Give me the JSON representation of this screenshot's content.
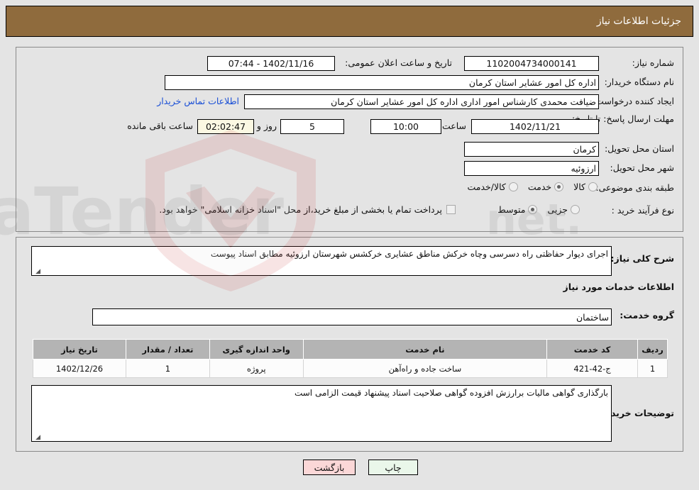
{
  "header": {
    "title": "جزئیات اطلاعات نیاز"
  },
  "form": {
    "need_number_label": "شماره نیاز:",
    "need_number_value": "1102004734000141",
    "public_announce_label": "تاریخ و ساعت اعلان عمومی:",
    "public_announce_value": "1402/11/16 - 07:44",
    "buyer_org_label": "نام دستگاه خریدار:",
    "buyer_org_value": "اداره کل امور عشایر استان کرمان",
    "requester_label": "ایجاد کننده درخواست:",
    "requester_value": "ضیافت محمدی کارشناس امور اداری اداره کل امور عشایر استان کرمان",
    "buyer_contact_link": "اطلاعات تماس خریدار",
    "deadline_label": "مهلت ارسال پاسخ: تا تاریخ:",
    "deadline_date": "1402/11/21",
    "deadline_hour_label": "ساعت",
    "deadline_hour_value": "10:00",
    "remaining_days": "5",
    "remaining_days_label": "روز و",
    "remaining_time": "02:02:47",
    "remaining_suffix_label": "ساعت باقی مانده",
    "province_label": "استان محل تحویل:",
    "province_value": "کرمان",
    "city_label": "شهر محل تحویل:",
    "city_value": "ارزوئیه",
    "category_label": "طبقه بندی موضوعی:",
    "category_options": [
      {
        "label": "کالا",
        "selected": false
      },
      {
        "label": "خدمت",
        "selected": true
      },
      {
        "label": "کالا/خدمت",
        "selected": false
      }
    ],
    "purchase_type_label": "نوع فرآیند خرید :",
    "purchase_type_options": [
      {
        "label": "جزیی",
        "selected": false
      },
      {
        "label": "متوسط",
        "selected": true
      }
    ],
    "treasury_checkbox_label": "پرداخت تمام یا بخشی از مبلغ خرید،از محل \"اسناد خزانه اسلامی\" خواهد بود.",
    "treasury_checked": false
  },
  "description": {
    "label": "شرح کلی نیاز:",
    "value": "اجرای دیوار حفاظتی راه دسرسی وچاه خرکش مناطق عشایری خرکشس شهرستان ارزوئیه مطابق اسناد پیوست"
  },
  "services_section": {
    "heading": "اطلاعات خدمات مورد نیاز",
    "service_group_label": "گروه خدمت:",
    "service_group_value": "ساختمان",
    "table": {
      "columns": [
        "ردیف",
        "کد خدمت",
        "نام خدمت",
        "واحد اندازه گیری",
        "تعداد / مقدار",
        "تاریخ نیاز"
      ],
      "rows": [
        [
          "1",
          "ج-42-421",
          "ساخت جاده و راه‌آهن",
          "پروژه",
          "1",
          "1402/12/26"
        ]
      ]
    }
  },
  "buyer_notes": {
    "label": "توضیحات خریدار:",
    "value": "بارگذاری گواهی مالیات برارزش افزوده گواهی صلاحیت اسناد پیشنهاد قیمت الزامی است"
  },
  "buttons": {
    "print": "چاپ",
    "back": "بازگشت"
  },
  "watermark": {
    "text": "AriaTender.net"
  }
}
